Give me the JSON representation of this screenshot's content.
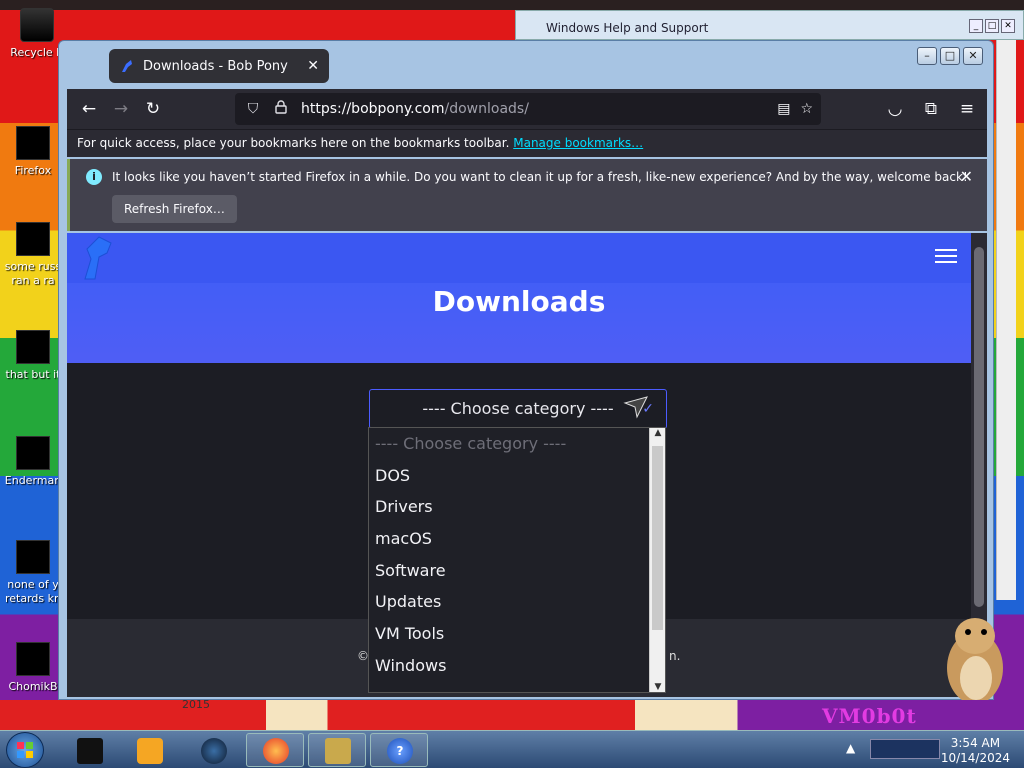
{
  "desktop": {
    "icons": [
      {
        "label": "Recycle B"
      },
      {
        "label": "Firefox"
      },
      {
        "label": "some russ",
        "label2": "ran a ra"
      },
      {
        "label": "that but it"
      },
      {
        "label": "Enderman"
      },
      {
        "label": "none of y",
        "label2": "retards kn"
      },
      {
        "label": "ChomikB"
      }
    ],
    "year_text": "2015",
    "art_text": "VM0b0t"
  },
  "background_window": {
    "title": "Windows Help and Support"
  },
  "browser": {
    "tab": {
      "title": "Downloads - Bob Pony"
    },
    "url": {
      "host": "https://bobpony.com",
      "path": "/downloads/"
    },
    "bookmarks_bar": {
      "text": "For quick access, place your bookmarks here on the bookmarks toolbar.",
      "link": "Manage bookmarks…"
    },
    "notification": {
      "message": "It looks like you haven’t started Firefox in a while. Do you want to clean it up for a fresh, like-new experience? And by the way, welcome back!",
      "button": "Refresh Firefox…"
    }
  },
  "page": {
    "heading": "Downloads",
    "select": {
      "selected": "---- Choose category ----",
      "options": [
        "---- Choose category ----",
        "DOS",
        "Drivers",
        "macOS",
        "Software",
        "Updates",
        "VM Tools",
        "Windows"
      ]
    },
    "footer_fragment_left": "©",
    "footer_fragment_right": "n."
  },
  "taskbar": {
    "clock_time": "3:54 AM",
    "clock_date": "10/14/2024"
  },
  "colors": {
    "hero": "#3b5ef7",
    "accent_link": "#00ddff",
    "page_bg": "#1c1d24"
  }
}
